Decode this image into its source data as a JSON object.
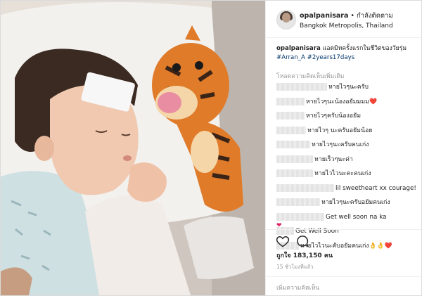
{
  "post": {
    "username": "opalpanisara",
    "separator": "•",
    "follow_label": "กำลังติดตาม",
    "location": "Bangkok Metropolis, Thailand"
  },
  "caption": {
    "username": "opalpanisara",
    "text": "แอดมิทครั้งแรกในชีวิตของวัยรุ่ม",
    "tags": "#Arran_A #2years17days"
  },
  "load_more": "โหลดความคิดเห็นเพิ่มเติม",
  "comments": [
    {
      "text": "หายไวๆนะครับ"
    },
    {
      "text": "หายไวๆนะน้องอยัมมมม❤️"
    },
    {
      "text": "หายไวๆครับน้องอยัม"
    },
    {
      "text": "หายไวๆ นะครับอยัมน้อย"
    },
    {
      "text": "หายไวๆนะครับคนเก่ง"
    },
    {
      "text": "หายเร็วๆนะค่า"
    },
    {
      "text": "หายไวไวนะคะคนเก่ง"
    },
    {
      "text": "lil sweetheart xx courage!"
    },
    {
      "text": "หายไวๆนะครับอยัมคนเก่ง"
    },
    {
      "text": "Get well soon na ka"
    },
    {
      "text": "Get Well Soon"
    },
    {
      "text": "หายไวไวนะคับอยัมคนเก่ง👌👌❤️"
    }
  ],
  "heart": "❤",
  "likes": "ถูกใจ 183,150 คน",
  "time": "15 ชั่วโมงที่แล้ว",
  "add_comment_placeholder": "เพิ่มความคิดเห็น",
  "icons": {
    "like": "heart-outline-icon",
    "comment": "speech-bubble-icon"
  },
  "colors": {
    "link": "#003569",
    "muted": "#999999",
    "heart": "#e0245e"
  }
}
